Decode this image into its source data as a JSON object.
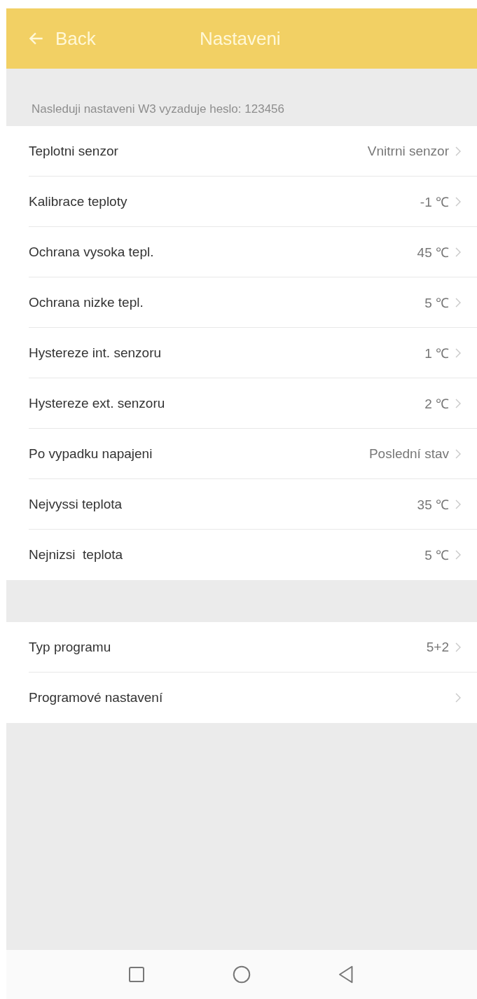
{
  "header": {
    "back": "Back",
    "title": "Nastaveni"
  },
  "note": "Nasleduji nastaveni W3 vyzaduje heslo: 123456",
  "groups": [
    {
      "items": [
        {
          "label": "Teplotni senzor",
          "value": "Vnitrni senzor"
        },
        {
          "label": "Kalibrace teploty",
          "value": "-1 ℃"
        },
        {
          "label": "Ochrana vysoka tepl.",
          "value": "45 ℃"
        },
        {
          "label": "Ochrana nizke tepl.",
          "value": "5 ℃"
        },
        {
          "label": "Hystereze int. senzoru",
          "value": "1 ℃"
        },
        {
          "label": "Hystereze ext. senzoru",
          "value": "2 ℃"
        },
        {
          "label": "Po vypadku napajeni",
          "value": "Poslední stav"
        },
        {
          "label": "Nejvyssi teplota",
          "value": "35 ℃"
        },
        {
          "label": "Nejnizsi  teplota",
          "value": "5 ℃"
        }
      ]
    },
    {
      "items": [
        {
          "label": "Typ programu",
          "value": "5+2"
        },
        {
          "label": "Programové nastavení"
        }
      ]
    }
  ]
}
